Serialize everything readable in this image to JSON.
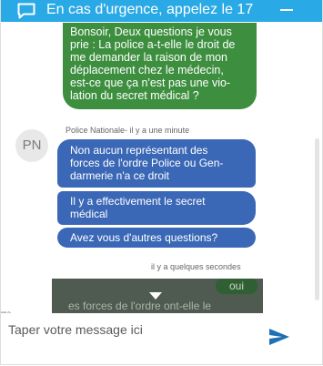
{
  "header": {
    "title": "En cas d'urgence, appelez le 17",
    "icon": "chat-bubble-icon",
    "minimize_icon": "minimize-icon"
  },
  "conversation": {
    "user_message": [
      "Bonsoir, Deux questions je vous",
      "prie : La police a-t-elle le droit de",
      "me demander la raison de mon",
      "déplacement chez le médecin,",
      "est-ce que ça n'est pas une vio-",
      "lation du secret médical ?"
    ],
    "agent_meta": "Police Nationale- il y a une minute",
    "agent_initials": "PN",
    "agent_messages": [
      [
        "Non aucun représentant des",
        "forces de l'ordre Police ou Gen-",
        "darmerie n'a ce droit"
      ],
      [
        "Il y a effectivement le secret",
        "médical"
      ],
      [
        "Avez vous d'autres questions?"
      ]
    ],
    "time_meta": "il y a quelques secondes",
    "partial_reply": "oui",
    "partial_text": "es forces de l'ordre ont-elle le",
    "edge_label": "ma"
  },
  "input": {
    "placeholder": "Taper votre message ici",
    "send_icon": "send-icon"
  },
  "colors": {
    "header": "#29a9e6",
    "user_bubble": "#3d8f3f",
    "agent_bubble": "#3b68b6",
    "send": "#1f6fb5"
  }
}
